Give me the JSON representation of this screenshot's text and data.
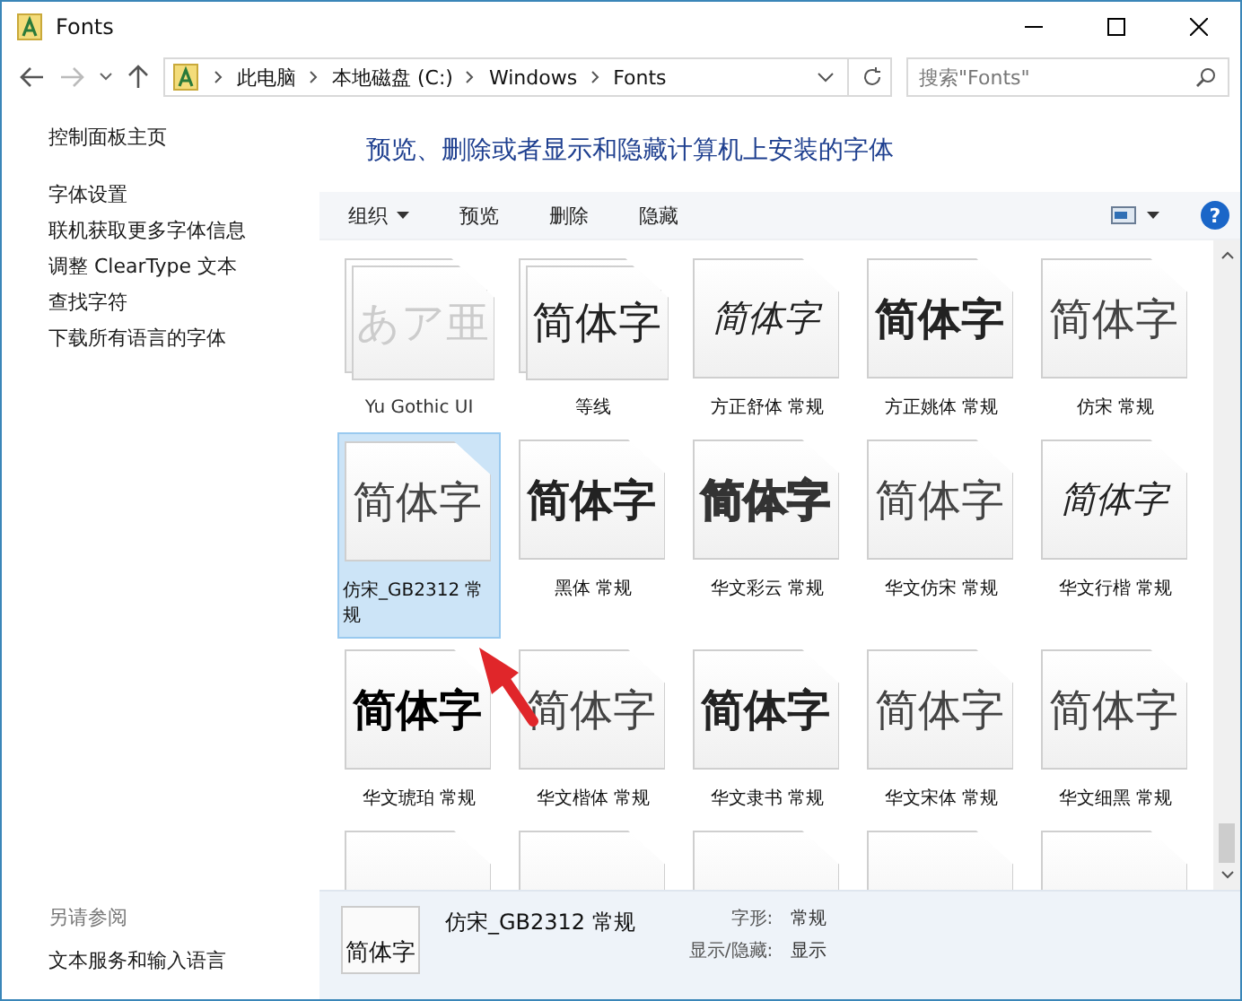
{
  "window": {
    "title": "Fonts"
  },
  "address": {
    "crumbs": [
      "此电脑",
      "本地磁盘 (C:)",
      "Windows",
      "Fonts"
    ]
  },
  "search": {
    "placeholder": "搜索\"Fonts\""
  },
  "sidebar": {
    "home": "控制面板主页",
    "items": [
      "字体设置",
      "联机获取更多字体信息",
      "调整 ClearType 文本",
      "查找字符",
      "下载所有语言的字体"
    ],
    "see_also_heading": "另请参阅",
    "see_also": [
      "文本服务和输入语言"
    ]
  },
  "header": "预览、删除或者显示和隐藏计算机上安装的字体",
  "toolbar": {
    "items": [
      {
        "label": "组织",
        "menu": true
      },
      {
        "label": "预览",
        "menu": false
      },
      {
        "label": "删除",
        "menu": false
      },
      {
        "label": "隐藏",
        "menu": false
      }
    ],
    "help": "?"
  },
  "fonts": [
    {
      "name": "Yu Gothic UI",
      "sample": "あア亜",
      "kind": "regular",
      "family": true,
      "hidden": true,
      "selected": false
    },
    {
      "name": "等线",
      "sample": "简体字",
      "kind": "regular",
      "family": true,
      "hidden": false,
      "selected": false
    },
    {
      "name": "方正舒体 常规",
      "sample": "简体字",
      "kind": "script",
      "family": false,
      "hidden": false,
      "selected": false
    },
    {
      "name": "方正姚体 常规",
      "sample": "简体字",
      "kind": "bold",
      "family": false,
      "hidden": false,
      "selected": false
    },
    {
      "name": "仿宋 常规",
      "sample": "简体字",
      "kind": "light",
      "family": false,
      "hidden": false,
      "selected": false
    },
    {
      "name": "仿宋_GB2312 常规",
      "sample": "简体字",
      "kind": "light",
      "family": false,
      "hidden": false,
      "selected": true
    },
    {
      "name": "黑体 常规",
      "sample": "简体字",
      "kind": "bold",
      "family": false,
      "hidden": false,
      "selected": false
    },
    {
      "name": "华文彩云 常规",
      "sample": "简体字",
      "kind": "outline",
      "family": false,
      "hidden": false,
      "selected": false
    },
    {
      "name": "华文仿宋 常规",
      "sample": "简体字",
      "kind": "light",
      "family": false,
      "hidden": false,
      "selected": false
    },
    {
      "name": "华文行楷 常规",
      "sample": "简体字",
      "kind": "script",
      "family": false,
      "hidden": false,
      "selected": false
    },
    {
      "name": "华文琥珀 常规",
      "sample": "简体字",
      "kind": "heavy",
      "family": false,
      "hidden": false,
      "selected": false
    },
    {
      "name": "华文楷体 常规",
      "sample": "简体字",
      "kind": "light",
      "family": false,
      "hidden": false,
      "selected": false
    },
    {
      "name": "华文隶书 常规",
      "sample": "简体字",
      "kind": "bold",
      "family": false,
      "hidden": false,
      "selected": false
    },
    {
      "name": "华文宋体 常规",
      "sample": "简体字",
      "kind": "light",
      "family": false,
      "hidden": false,
      "selected": false
    },
    {
      "name": "华文细黑 常规",
      "sample": "简体字",
      "kind": "light",
      "family": false,
      "hidden": false,
      "selected": false
    },
    {
      "selected": false
    },
    {
      "selected": false
    },
    {
      "selected": false
    },
    {
      "selected": false
    },
    {
      "selected": false
    }
  ],
  "details": {
    "sample": "简体字",
    "name": "仿宋_GB2312 常规",
    "fields": [
      {
        "label": "字形:",
        "value": "常规"
      },
      {
        "label": "显示/隐藏:",
        "value": "显示"
      }
    ]
  }
}
